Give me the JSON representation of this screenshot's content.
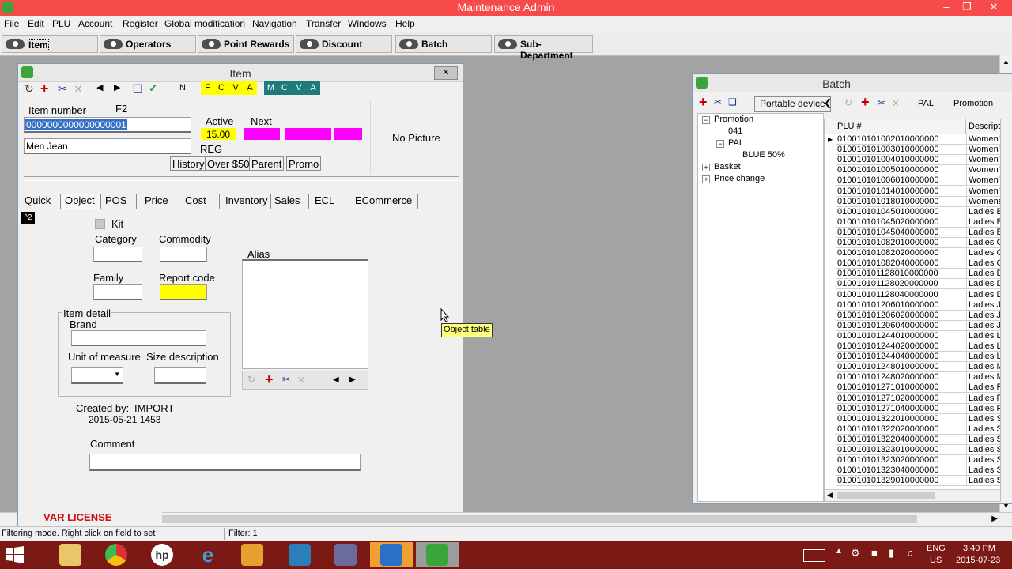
{
  "app": {
    "title": "Maintenance  Admin"
  },
  "menu": [
    "File",
    "Edit",
    "PLU",
    "Account",
    "Register",
    "Global modification",
    "Navigation",
    "Transfer",
    "Windows",
    "Help"
  ],
  "toolbar_buttons": [
    "Item",
    "Operators",
    "Point Rewards",
    "Discount",
    "Batch",
    "Sub-Department"
  ],
  "item_window": {
    "title": "Item",
    "toolbar_letters": {
      "n": "N",
      "fcva": [
        "F",
        "C",
        "V",
        "A"
      ],
      "mcva": [
        "M",
        "C",
        "V",
        "A"
      ]
    },
    "item_number_label": "Item number",
    "f2_label": "F2",
    "item_number_value": "0000000000000000001",
    "description_value": "Men Jean",
    "active_label": "Active",
    "next_label": "Next",
    "active_price": "15.00",
    "reg_label": "REG",
    "no_picture": "No Picture",
    "buttons": [
      "History",
      "Over $50",
      "Parent",
      "Promo"
    ],
    "tabs": [
      "Quick",
      "Object",
      "POS",
      "Price",
      "Cost",
      "Inventory",
      "Sales",
      "ECL",
      "ECommerce"
    ],
    "badge": "^2",
    "kit_label": "Kit",
    "category_label": "Category",
    "commodity_label": "Commodity",
    "family_label": "Family",
    "report_code_label": "Report code",
    "alias_label": "Alias",
    "item_detail_label": "Item detail",
    "brand_label": "Brand",
    "unit_label": "Unit of measure",
    "size_label": "Size description",
    "created_by_label": "Created by:",
    "created_by_value": "IMPORT",
    "created_date": "2015-05-21  1453",
    "comment_label": "Comment",
    "tooltip": "Object table",
    "license": "VAR LICENSE"
  },
  "batch_window": {
    "title": "Batch",
    "portable_device": "Portable device",
    "pal_label": "PAL",
    "promotion_label": "Promotion",
    "tree": [
      "Promotion",
      "041",
      "PAL",
      "BLUE 50%",
      "Basket",
      "Price change"
    ],
    "columns": [
      "PLU #",
      "Descripti"
    ],
    "rows": [
      [
        "010010101002010000000",
        "Women's"
      ],
      [
        "010010101003010000000",
        "Women's"
      ],
      [
        "010010101004010000000",
        "Women's"
      ],
      [
        "010010101005010000000",
        "Women's"
      ],
      [
        "010010101006010000000",
        "Women's"
      ],
      [
        "010010101014010000000",
        "Women's"
      ],
      [
        "010010101018010000000",
        "Womens"
      ],
      [
        "010010101045010000000",
        "Ladies Bl"
      ],
      [
        "010010101045020000000",
        "Ladies Bl"
      ],
      [
        "010010101045040000000",
        "Ladies Bl"
      ],
      [
        "010010101082010000000",
        "Ladies C"
      ],
      [
        "010010101082020000000",
        "Ladies C"
      ],
      [
        "010010101082040000000",
        "Ladies C"
      ],
      [
        "010010101128010000000",
        "Ladies D"
      ],
      [
        "010010101128020000000",
        "Ladies D"
      ],
      [
        "010010101128040000000",
        "Ladies D"
      ],
      [
        "010010101206010000000",
        "Ladies Je"
      ],
      [
        "010010101206020000000",
        "Ladies Je"
      ],
      [
        "010010101206040000000",
        "Ladies Je"
      ],
      [
        "010010101244010000000",
        "Ladies Li"
      ],
      [
        "010010101244020000000",
        "Ladies Li"
      ],
      [
        "010010101244040000000",
        "Ladies Li"
      ],
      [
        "010010101248010000000",
        "Ladies M"
      ],
      [
        "010010101248020000000",
        "Ladies M"
      ],
      [
        "010010101271010000000",
        "Ladies P"
      ],
      [
        "010010101271020000000",
        "Ladies P"
      ],
      [
        "010010101271040000000",
        "Ladies P"
      ],
      [
        "010010101322010000000",
        "Ladies Sl"
      ],
      [
        "010010101322020000000",
        "Ladies Sl"
      ],
      [
        "010010101322040000000",
        "Ladies Sl"
      ],
      [
        "010010101323010000000",
        "Ladies Sl"
      ],
      [
        "010010101323020000000",
        "Ladies Sl"
      ],
      [
        "010010101323040000000",
        "Ladies Sl"
      ],
      [
        "010010101329010000000",
        "Ladies Sl"
      ]
    ]
  },
  "status": {
    "left": "Filtering mode. Right click on field to set",
    "filter": "Filter: 1"
  },
  "taskbar": {
    "lang": "ENG",
    "region": "US",
    "time": "3:40 PM",
    "date": "2015-07-23"
  },
  "colors": {
    "titlebar": "#f74b4b",
    "taskbar": "#7b1915",
    "highlight_yellow": "#ffff00",
    "magenta": "#ff00ff",
    "teal": "#1f7a7a"
  }
}
